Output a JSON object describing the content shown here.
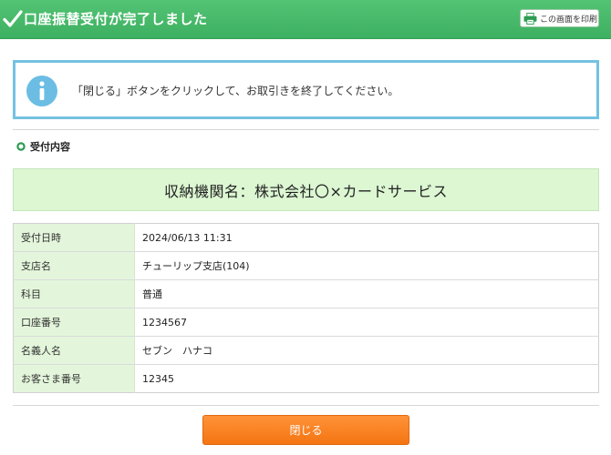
{
  "header": {
    "title": "口座振替受付が完了しました",
    "print_label": "この画面を印刷",
    "check_icon": "checkmark-icon",
    "print_icon": "printer-icon"
  },
  "info": {
    "icon": "info-icon",
    "message": "「閉じる」ボタンをクリックして、お取引きを終了してください。"
  },
  "section": {
    "title": "受付内容"
  },
  "organization": "収納機関名：株式会社〇×カードサービス",
  "details": [
    {
      "label": "受付日時",
      "value": "2024/06/13 11:31"
    },
    {
      "label": "支店名",
      "value": "チューリップ支店(104)"
    },
    {
      "label": "科目",
      "value": "普通"
    },
    {
      "label": "口座番号",
      "value": "1234567"
    },
    {
      "label": "名義人名",
      "value": "セブン　ハナコ"
    },
    {
      "label": "お客さま番号",
      "value": "12345"
    }
  ],
  "close_button": {
    "label": "閉じる"
  },
  "colors": {
    "header": "#47b86a",
    "info_border": "#74c2e1",
    "label_cell": "#e3f6db",
    "org_box": "#dcf7d2",
    "close_button": "#f58020"
  }
}
